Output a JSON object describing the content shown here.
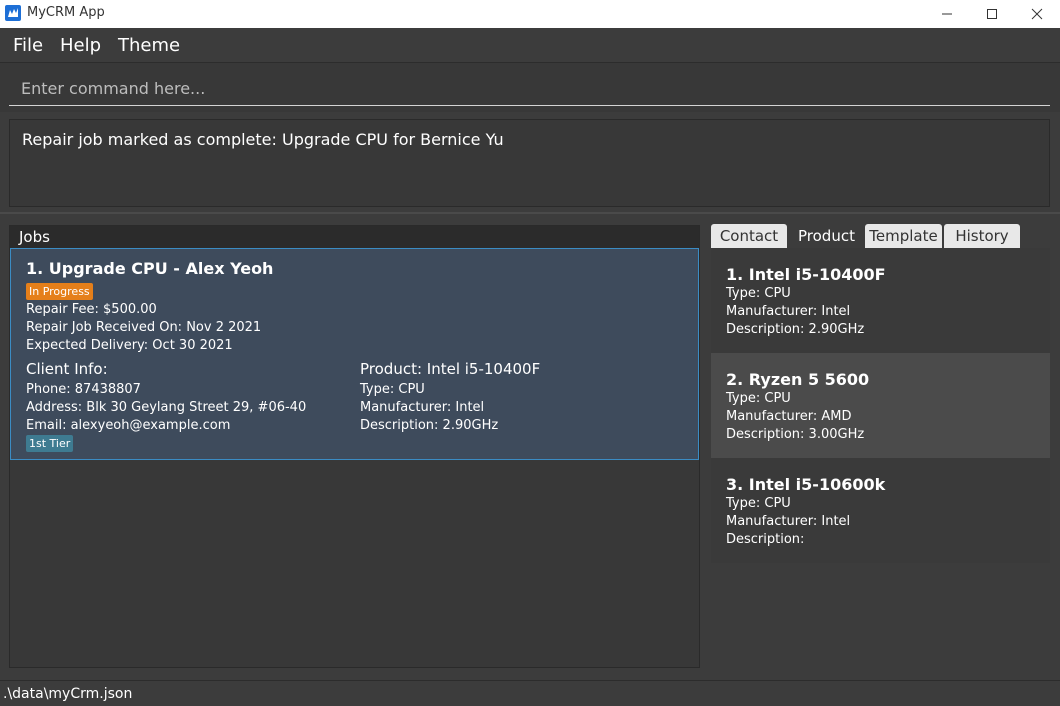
{
  "window": {
    "title": "MyCRM App"
  },
  "menu": {
    "file": "File",
    "help": "Help",
    "theme": "Theme"
  },
  "command": {
    "placeholder": "Enter command here..."
  },
  "result": {
    "text": "Repair job marked as complete: Upgrade CPU for Bernice Yu"
  },
  "jobs": {
    "title": "Jobs",
    "items": [
      {
        "title": "1. Upgrade CPU - Alex Yeoh",
        "status": "In Progress",
        "fee": "Repair Fee: $500.00",
        "received": "Repair Job Received On: Nov 2 2021",
        "delivery": "Expected Delivery: Oct 30 2021",
        "client_head": "Client Info:",
        "phone": "Phone: 87438807",
        "address": "Address: Blk 30 Geylang Street 29, #06-40",
        "email": "Email: alexyeoh@example.com",
        "tier": "1st Tier",
        "product_head": "Product: Intel i5-10400F",
        "product_type": "Type: CPU",
        "product_manufacturer": "Manufacturer: Intel",
        "product_description": "Description: 2.90GHz"
      }
    ]
  },
  "tabs": {
    "contact": "Contact",
    "product": "Product",
    "template": "Template",
    "history": "History"
  },
  "products": [
    {
      "name": "1.  Intel i5-10400F",
      "type": "Type: CPU",
      "manufacturer": "Manufacturer: Intel",
      "description": "Description: 2.90GHz"
    },
    {
      "name": "2.  Ryzen 5 5600",
      "type": "Type: CPU",
      "manufacturer": "Manufacturer: AMD",
      "description": "Description: 3.00GHz"
    },
    {
      "name": "3.  Intel i5-10600k",
      "type": "Type: CPU",
      "manufacturer": "Manufacturer: Intel",
      "description": "Description:"
    }
  ],
  "status": {
    "path": ".\\data\\myCrm.json"
  }
}
